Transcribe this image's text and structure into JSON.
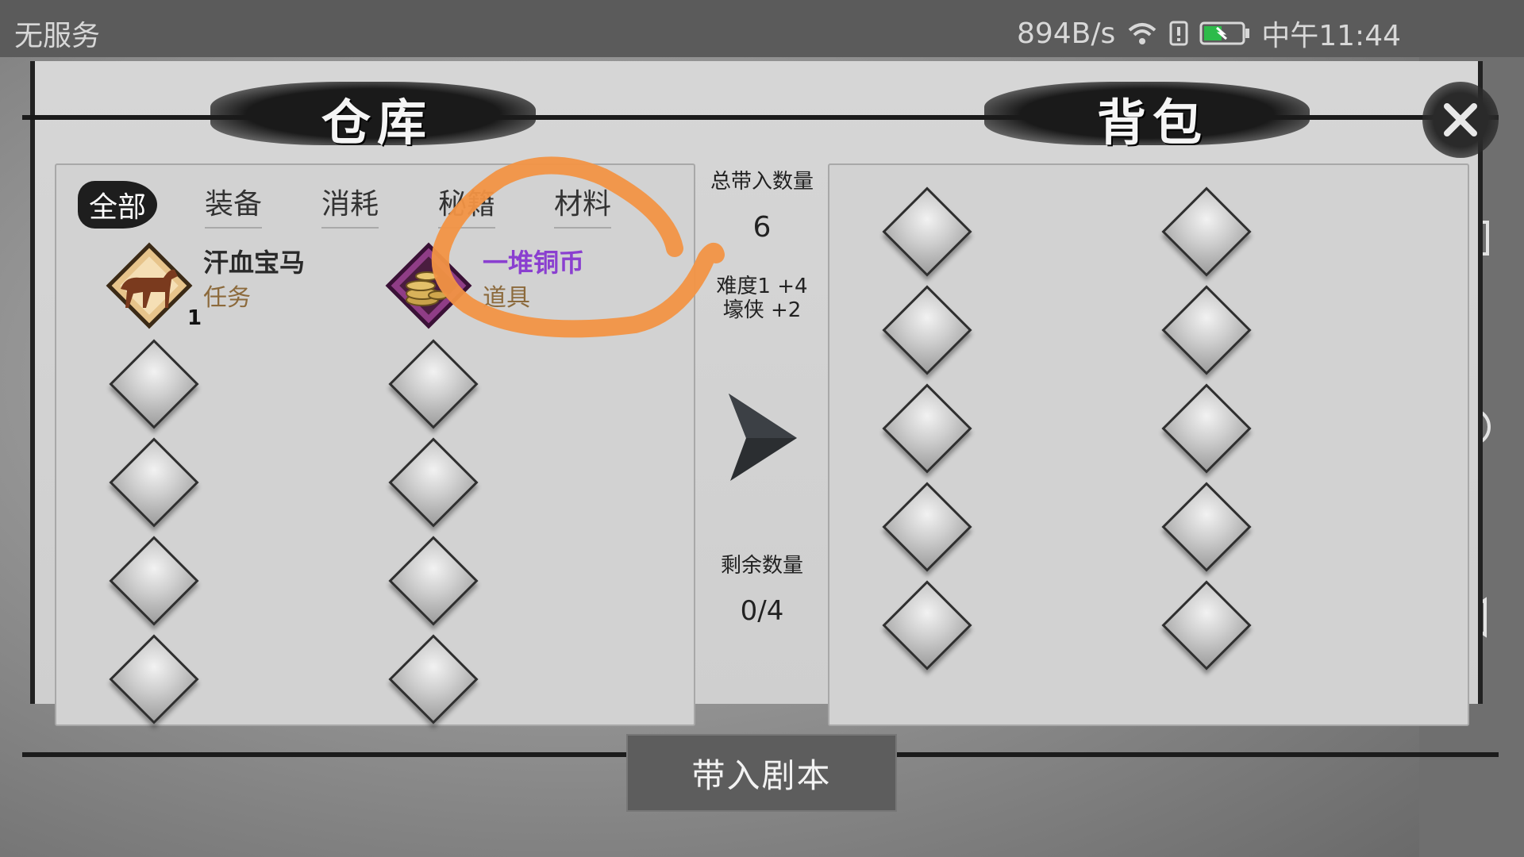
{
  "status_bar": {
    "carrier": "无服务",
    "net_speed": "894B/s",
    "time": "中午11:44"
  },
  "warehouse": {
    "title": "仓库",
    "tabs": [
      {
        "label": "全部",
        "active": true
      },
      {
        "label": "装备",
        "active": false
      },
      {
        "label": "消耗",
        "active": false
      },
      {
        "label": "秘籍",
        "active": false
      },
      {
        "label": "材料",
        "active": false
      }
    ],
    "items": [
      {
        "name": "汗血宝马",
        "type": "任务",
        "count": "1",
        "name_color": "#2a2a2a",
        "icon": "horse-icon"
      },
      {
        "name": "一堆铜币",
        "type": "道具",
        "count": "",
        "name_color": "#8a3fd0",
        "icon": "coins-icon"
      }
    ]
  },
  "transfer": {
    "total_label": "总带入数量",
    "total_value": "6",
    "bonus_lines": [
      "难度1 +4",
      "壕侠 +2"
    ],
    "remaining_label": "剩余数量",
    "remaining_value": "0/4"
  },
  "backpack": {
    "title": "背包"
  },
  "actions": {
    "bring_in_label": "带入剧本"
  },
  "colors": {
    "annotation": "#f29444"
  }
}
